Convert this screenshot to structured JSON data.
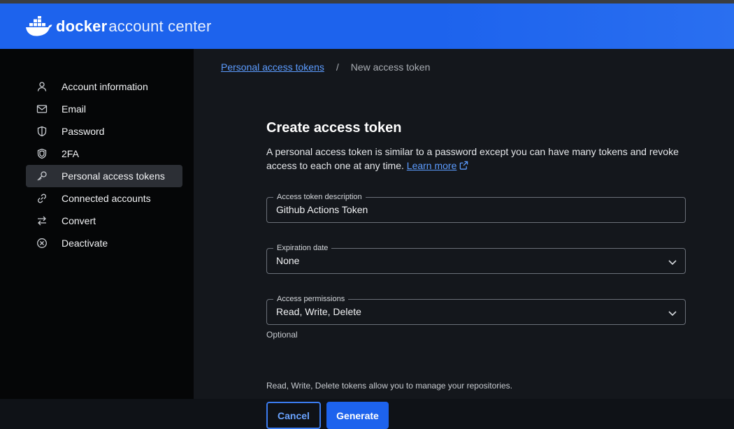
{
  "app": {
    "logo_primary": "docker",
    "logo_secondary": "account center",
    "brand_color": "#1d63ed"
  },
  "sidebar": {
    "items": [
      {
        "label": "Account information",
        "icon": "user-icon",
        "active": false
      },
      {
        "label": "Email",
        "icon": "mail-icon",
        "active": false
      },
      {
        "label": "Password",
        "icon": "shield-icon",
        "active": false
      },
      {
        "label": "2FA",
        "icon": "shield-double-icon",
        "active": false
      },
      {
        "label": "Personal access tokens",
        "icon": "key-icon",
        "active": true
      },
      {
        "label": "Connected accounts",
        "icon": "link-icon",
        "active": false
      },
      {
        "label": "Convert",
        "icon": "swap-icon",
        "active": false
      },
      {
        "label": "Deactivate",
        "icon": "circle-x-icon",
        "active": false
      }
    ]
  },
  "breadcrumb": {
    "parent": "Personal access tokens",
    "separator": "/",
    "current": "New access token"
  },
  "form": {
    "title": "Create access token",
    "description": "A personal access token is similar to a password except you can have many tokens and revoke access to each one at any time.",
    "learn_more": "Learn more",
    "token_description": {
      "label": "Access token description",
      "value": "Github Actions Token"
    },
    "expiration": {
      "label": "Expiration date",
      "value": "None"
    },
    "optional_label": "Optional",
    "permissions": {
      "label": "Access permissions",
      "value": "Read, Write, Delete"
    },
    "helper_text": "Read, Write, Delete tokens allow you to manage your repositories.",
    "cancel_label": "Cancel",
    "generate_label": "Generate"
  }
}
